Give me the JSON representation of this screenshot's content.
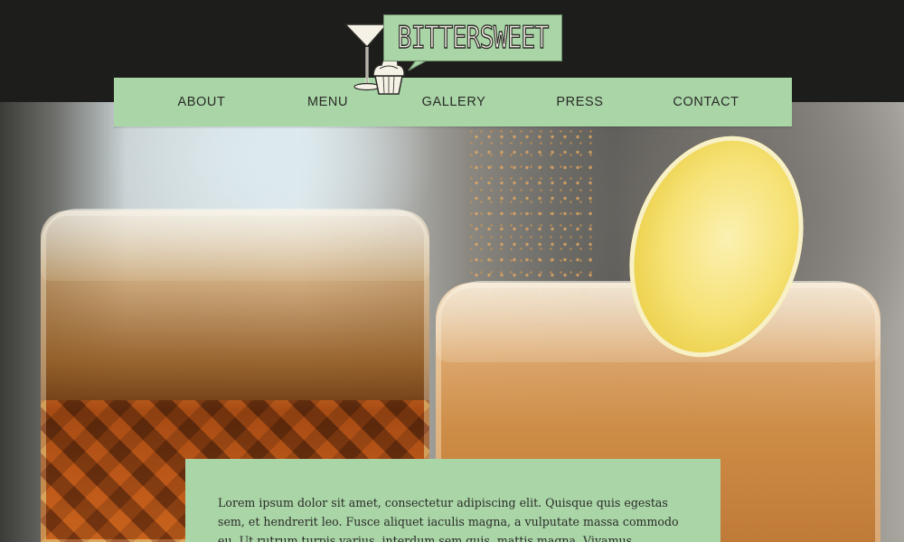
{
  "brand": {
    "name": "BITTERSWEET"
  },
  "nav": {
    "items": [
      {
        "label": "ABOUT"
      },
      {
        "label": "MENU"
      },
      {
        "label": "GALLERY"
      },
      {
        "label": "PRESS"
      },
      {
        "label": "CONTACT"
      }
    ]
  },
  "hero": {
    "image": "cocktail-glasses-photo"
  },
  "content": {
    "paragraph": "Lorem ipsum dolor sit amet, consectetur adipiscing elit. Quisque quis egestas sem, et hendrerit leo. Fusce aliquet iaculis magna, a vulputate massa commodo eu. Ut rutrum turpis varius, interdum sem quis, mattis magna. Vivamus pellentesque, dui"
  },
  "colors": {
    "topbar": "#1d1e1b",
    "accent_green": "#a9d5a7",
    "text_dark": "#2a2b27"
  }
}
